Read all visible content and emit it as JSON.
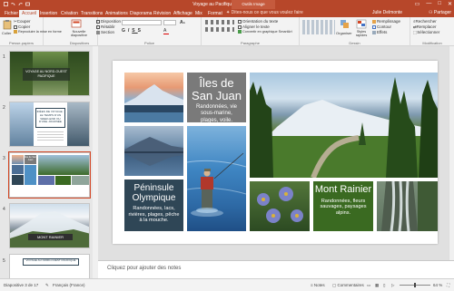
{
  "window": {
    "title": "Voyage au Pacifique - PowerPoint",
    "tools_label": "Outils Image",
    "minimize": "—",
    "maximize": "□",
    "close": "✕"
  },
  "tabs": {
    "file": "Fichier",
    "home": "Accueil",
    "insert": "Insertion",
    "design": "Création",
    "transitions": "Transitions",
    "animations": "Animations",
    "slideshow": "Diaporama",
    "review": "Révision",
    "view": "Affichage",
    "mix": "Mix",
    "format": "Format",
    "tell_me": "Dites-nous ce que vous voulez faire",
    "user": "Julie Delmonte",
    "share": "Partager"
  },
  "ribbon": {
    "paste": "Coller",
    "cut": "Couper",
    "copy": "Copier",
    "format_painter": "Reproduire la mise en forme",
    "clipboard_group": "Presse-papiers",
    "new_slide": "Nouvelle diapositive",
    "layout": "Disposition",
    "reset": "Rétablir",
    "section": "Section",
    "slides_group": "Diapositives",
    "font_group": "Police",
    "text_direction": "Orientation du texte",
    "align_text": "Aligner le texte",
    "smartart": "Convertir en graphique SmartArt",
    "paragraph_group": "Paragraphe",
    "arrange": "Organiser",
    "quick_styles": "Styles rapides",
    "shape_fill": "Remplissage",
    "shape_outline": "Contour",
    "shape_effects": "Effets",
    "drawing_group": "Dessin",
    "find": "Rechercher",
    "replace": "Remplacer",
    "select": "Sélectionner",
    "editing_group": "Modification"
  },
  "thumbnails": [
    {
      "num": "1",
      "title": "VOYAGE AU NORD-OUEST PACIFIQUE"
    },
    {
      "num": "2",
      "title": "IDÉES DE VOYAGE : LE TEMPS D'UN WEEK-END OU D'UNE JOURNÉE"
    },
    {
      "num": "3",
      "title": "Îles de San Juan"
    },
    {
      "num": "4",
      "title": "MONT RAINIER"
    },
    {
      "num": "5",
      "title": "VOYAGE AU NORD-OUEST PACIFIQUE"
    }
  ],
  "slide": {
    "tile1_title": "Îles de San Juan",
    "tile1_desc": "Randonnées, vie sous-marine, plages, voile.",
    "tile2_title": "Péninsule Olympique",
    "tile2_desc": "Randonnées, lacs, rivières, plages, pêche à la mouche.",
    "tile3_title": "Mont Rainier",
    "tile3_desc": "Randonnées, fleurs sauvages, paysages alpins."
  },
  "notes": {
    "placeholder": "Cliquez pour ajouter des notes"
  },
  "status": {
    "slide_info": "Diapositive 3 de 17",
    "language": "Français (France)",
    "notes_btn": "Notes",
    "comments_btn": "Commentaires",
    "zoom": "64 %"
  },
  "colors": {
    "accent": "#b7472a",
    "tile_gray": "#7a7a7a",
    "tile_navy": "#2f4656",
    "tile_green": "#3a6a21"
  }
}
